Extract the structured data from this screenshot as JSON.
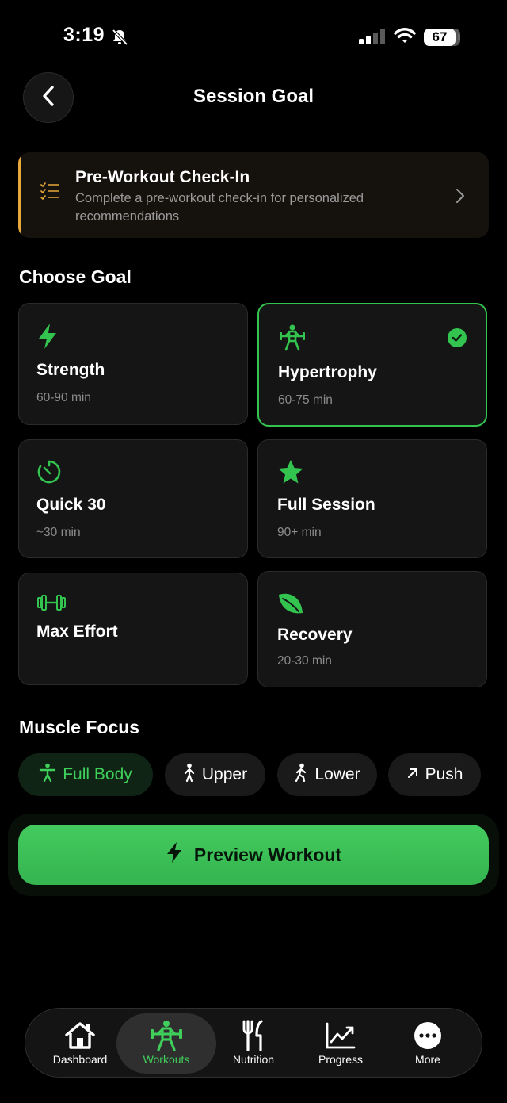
{
  "status_bar": {
    "time": "3:19",
    "battery": "67"
  },
  "header": {
    "title": "Session Goal"
  },
  "checkin": {
    "title": "Pre-Workout Check-In",
    "description": "Complete a pre-workout check-in for personalized recommendations"
  },
  "goals": {
    "section_title": "Choose Goal",
    "items": [
      {
        "name": "Strength",
        "duration": "60-90 min",
        "icon": "lightning-icon"
      },
      {
        "name": "Hypertrophy",
        "duration": "60-75 min",
        "icon": "weightlifter-icon",
        "selected": true
      },
      {
        "name": "Quick 30",
        "duration": "~30 min",
        "icon": "timer-icon"
      },
      {
        "name": "Full Session",
        "duration": "90+ min",
        "icon": "star-icon"
      },
      {
        "name": "Max Effort",
        "duration": "",
        "icon": "dumbbell-icon"
      },
      {
        "name": "Recovery",
        "duration": "20-30 min",
        "icon": "leaf-icon"
      }
    ]
  },
  "muscle_focus": {
    "section_title": "Muscle Focus",
    "chips": [
      {
        "label": "Full Body",
        "active": true
      },
      {
        "label": "Upper"
      },
      {
        "label": "Lower"
      },
      {
        "label": "Push"
      }
    ]
  },
  "preview_button": {
    "label": "Preview Workout"
  },
  "tabbar": {
    "tabs": [
      {
        "label": "Dashboard"
      },
      {
        "label": "Workouts",
        "active": true
      },
      {
        "label": "Nutrition"
      },
      {
        "label": "Progress"
      },
      {
        "label": "More"
      }
    ]
  },
  "colors": {
    "accent": "#33c44f",
    "warning": "#e8a83a",
    "background": "#000000"
  }
}
